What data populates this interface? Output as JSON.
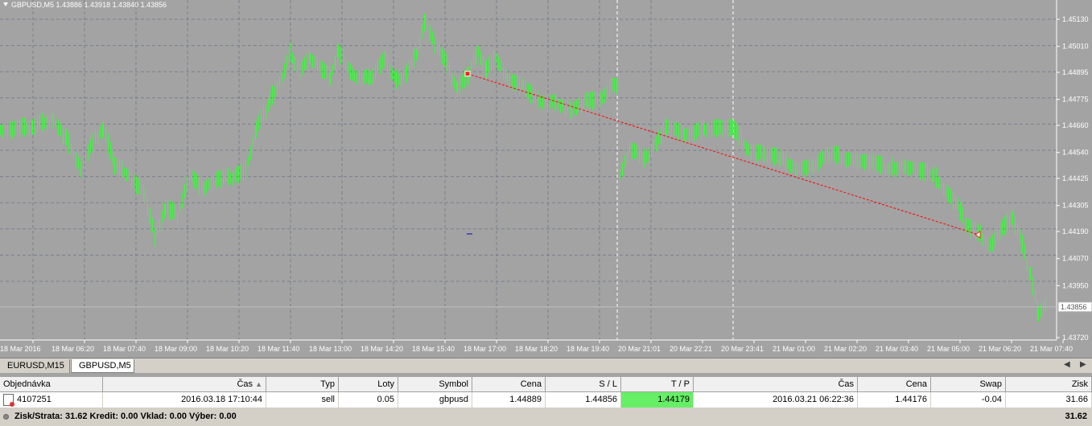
{
  "chart": {
    "title": "GBPUSD,M5  1.43886 1.43918 1.43840 1.43856",
    "price_ticks": [
      "1.45130",
      "1.45010",
      "1.44895",
      "1.44775",
      "1.44660",
      "1.44540",
      "1.44425",
      "1.44305",
      "1.44190",
      "1.44070",
      "1.43950",
      "1.43720"
    ],
    "current_price": "1.43856",
    "time_ticks": [
      "18 Mar 2016",
      "18 Mar 06:20",
      "18 Mar 07:40",
      "18 Mar 09:00",
      "18 Mar 10:20",
      "18 Mar 11:40",
      "18 Mar 13:00",
      "18 Mar 14:20",
      "18 Mar 15:40",
      "18 Mar 17:00",
      "18 Mar 18:20",
      "18 Mar 19:40",
      "20 Mar 21:01",
      "20 Mar 22:21",
      "20 Mar 23:41",
      "21 Mar 01:00",
      "21 Mar 02:20",
      "21 Mar 03:40",
      "21 Mar 05:00",
      "21 Mar 06:20",
      "21 Mar 07:40"
    ],
    "colors": {
      "background": "#a3a3a3",
      "bar": "#33ff33",
      "grid": "#7a7f8c",
      "trade_line": "#ff0000"
    }
  },
  "tabs": [
    {
      "label": "EURUSD,M15",
      "active": false
    },
    {
      "label": "GBPUSD,M5",
      "active": true
    }
  ],
  "terminal": {
    "columns": [
      "Objednávka",
      "Čas",
      "Typ",
      "Loty",
      "Symbol",
      "Cena",
      "S / L",
      "T / P",
      "Čas",
      "Cena",
      "Swap",
      "Zisk"
    ],
    "row": [
      "4107251",
      "2016.03.18 17:10:44",
      "sell",
      "0.05",
      "gbpusd",
      "1.44889",
      "1.44856",
      "1.44179",
      "2016.03.21 06:22:36",
      "1.44176",
      "-0.04",
      "31.66"
    ],
    "summary_text": "Zisk/Strata: 31.62  Kredit: 0.00  Vklad: 0.00  Výber: 0.00",
    "summary_total": "31.62"
  }
}
